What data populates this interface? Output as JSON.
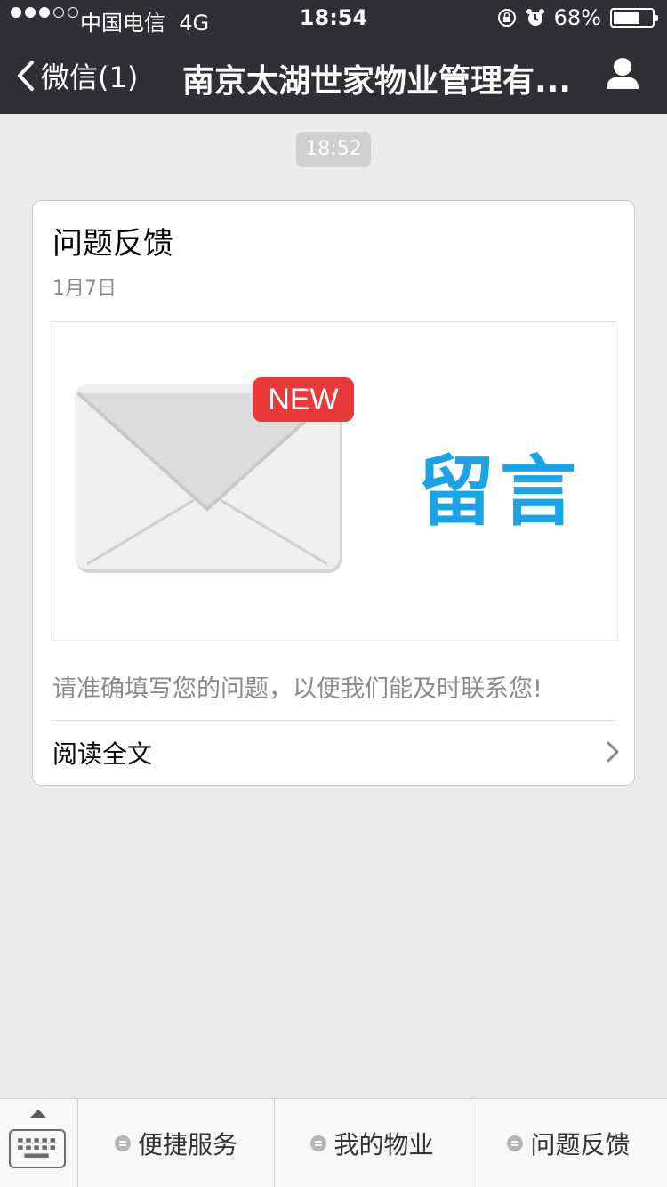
{
  "status_bar": {
    "carrier": "中国电信",
    "network": "4G",
    "time": "18:54",
    "battery": "68%",
    "battery_level": 0.68
  },
  "nav": {
    "back_label": "微信(1)",
    "title": "南京太湖世家物业管理有...",
    "profile_icon": "user-icon"
  },
  "chat": {
    "timestamp": "18:52"
  },
  "article_card": {
    "title": "问题反馈",
    "date": "1月7日",
    "cover": {
      "badge": "NEW",
      "text": "留言",
      "text_color": "#1aa3e6",
      "badge_color": "#e8393b"
    },
    "description": "请准确填写您的问题，以便我们能及时联系您!",
    "read_more": "阅读全文"
  },
  "bottom_menu": {
    "items": [
      {
        "label": "便捷服务"
      },
      {
        "label": "我的物业"
      },
      {
        "label": "问题反馈"
      }
    ]
  }
}
